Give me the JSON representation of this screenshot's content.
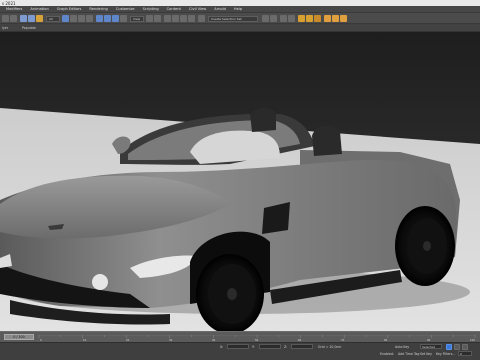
{
  "window": {
    "title": "s 2021"
  },
  "menu": {
    "items": [
      "Modifiers",
      "Animation",
      "Graph Editors",
      "Rendering",
      "Customize",
      "Scripting",
      "Content",
      "Civil View",
      "Arnold",
      "Help"
    ]
  },
  "toolbar": {
    "selection_filter": "All",
    "reference_coord": "View",
    "named_selection": "Create Selection Set"
  },
  "ribbon": {
    "left_label": "lyer",
    "right_label": "Populate"
  },
  "timeline": {
    "frame": "0 / 100",
    "tick_labels": [
      "0",
      "10",
      "20",
      "30",
      "40",
      "50",
      "60",
      "70",
      "80",
      "90",
      "100"
    ]
  },
  "statusbar": {
    "x_label": "X:",
    "y_label": "Y:",
    "z_label": "Z:",
    "grid_text": "Grid = 10,0cm",
    "auto_key": "Auto Key",
    "selected": "Selected",
    "set_key": "Set Key",
    "key_filters": "Key Filters...",
    "enabled": "Enabled:",
    "add_time_tag": "Add Time Tag",
    "frame_value": "0"
  },
  "colors": {
    "accent": "#3b78d9",
    "viewport_top": "#232323",
    "floor": "#cfcfcf",
    "car_body": "#8c8c8c",
    "car_dark": "#141414"
  }
}
